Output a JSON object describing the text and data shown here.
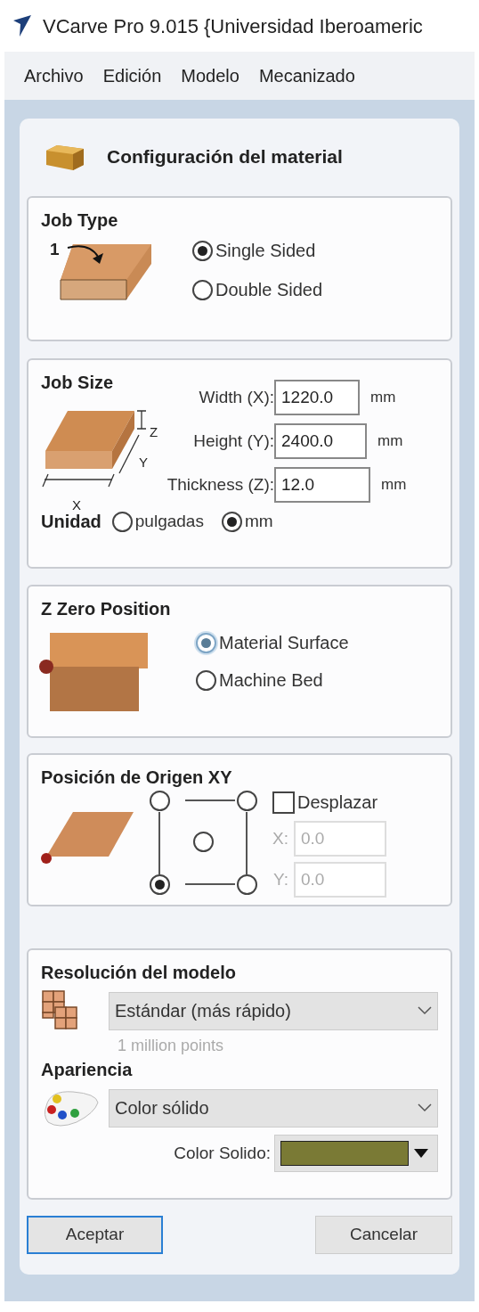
{
  "window": {
    "title": "VCarve Pro 9.015 {Universidad Iberoameric"
  },
  "menu": [
    "Archivo",
    "Edición",
    "Modelo",
    "Mecanizado"
  ],
  "panel": {
    "title": "Configuración del material"
  },
  "job_type": {
    "title": "Job Type",
    "marker": "1",
    "options": [
      {
        "label": "Single Sided",
        "selected": true
      },
      {
        "label": "Double Sided",
        "selected": false
      }
    ]
  },
  "job_size": {
    "title": "Job Size",
    "axis_labels": [
      "Z",
      "Y",
      "X"
    ],
    "fields": [
      {
        "label": "Width (X):",
        "value": "1220.0",
        "unit": "mm"
      },
      {
        "label": "Height (Y):",
        "value": "2400.0",
        "unit": "mm"
      },
      {
        "label": "Thickness (Z):",
        "value": "12.0",
        "unit": "mm"
      }
    ],
    "unit_label": "Unidad",
    "units": [
      {
        "label": "pulgadas",
        "selected": false
      },
      {
        "label": "mm",
        "selected": true
      }
    ]
  },
  "z_zero": {
    "title": "Z Zero Position",
    "options": [
      {
        "label": "Material Surface",
        "selected": true,
        "focused": true
      },
      {
        "label": "Machine Bed",
        "selected": false,
        "focused": false
      }
    ]
  },
  "xy_origin": {
    "title": "Posición de Origen XY",
    "anchors": [
      {
        "selected": false
      },
      {
        "selected": false
      },
      {
        "selected": false
      },
      {
        "selected": true
      },
      {
        "selected": false
      }
    ],
    "offset": {
      "label": "Desplazar",
      "checked": false
    },
    "fields": [
      {
        "label": "X:",
        "value": "0.0",
        "disabled": true
      },
      {
        "label": "Y:",
        "value": "0.0",
        "disabled": true
      }
    ]
  },
  "resolution": {
    "title": "Resolución del modelo",
    "value": "Estándar (más rápido)",
    "note": "1 million points"
  },
  "appearance": {
    "title": "Apariencia",
    "value": "Color sólido",
    "color_label": "Color Solido:",
    "color": "#7a7a35"
  },
  "buttons": [
    {
      "label": "Aceptar",
      "default": true
    },
    {
      "label": "Cancelar",
      "default": false
    }
  ]
}
